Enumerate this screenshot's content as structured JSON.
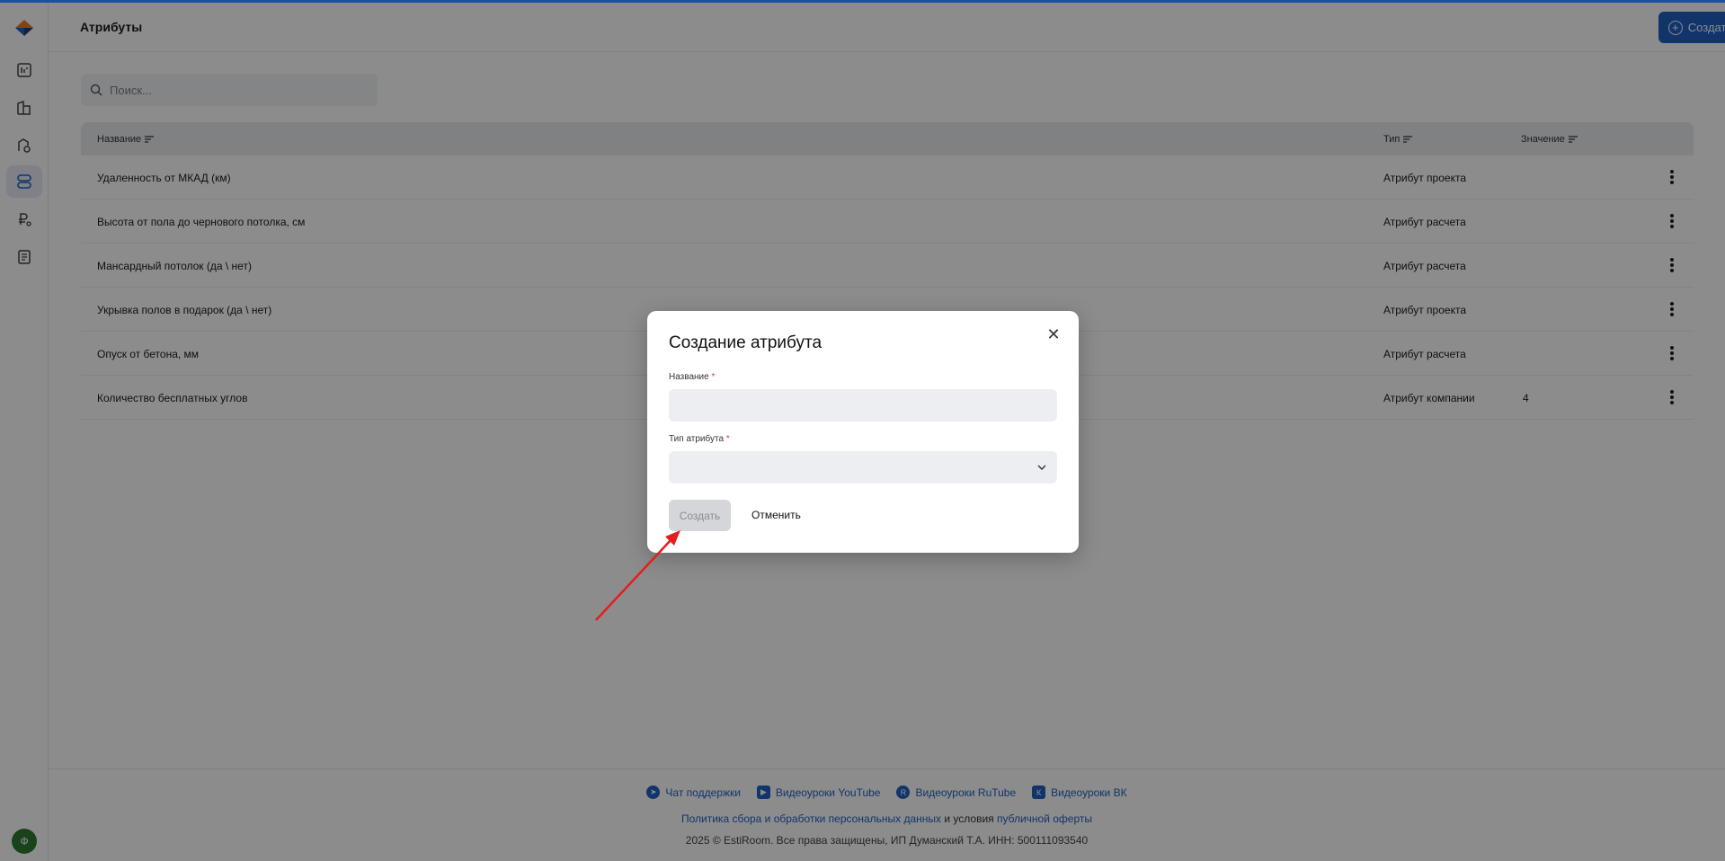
{
  "header": {
    "title": "Атрибуты",
    "create_label": "Создать"
  },
  "search": {
    "placeholder": "Поиск..."
  },
  "table": {
    "columns": [
      "Название",
      "Тип",
      "Значение"
    ],
    "rows": [
      {
        "name": "Удаленность от МКАД (км)",
        "type": "Атрибут проекта",
        "value": ""
      },
      {
        "name": "Высота от пола до чернового потолка, см",
        "type": "Атрибут расчета",
        "value": ""
      },
      {
        "name": "Мансардный потолок (да \\ нет)",
        "type": "Атрибут расчета",
        "value": ""
      },
      {
        "name": "Укрывка полов в подарок (да \\ нет)",
        "type": "Атрибут проекта",
        "value": ""
      },
      {
        "name": "Опуск от бетона, мм",
        "type": "Атрибут расчета",
        "value": ""
      },
      {
        "name": "Количество бесплатных углов",
        "type": "Атрибут компании",
        "value": "4"
      }
    ]
  },
  "sidebar": {
    "items": [
      "dashboard-icon",
      "buildings-icon",
      "materials-icon",
      "attributes-icon",
      "pricing-icon",
      "documents-icon"
    ],
    "user_initial": "Ф"
  },
  "footer": {
    "links": [
      {
        "label": "Чат поддержки",
        "icon": "telegram-icon"
      },
      {
        "label": "Видеоуроки YouTube",
        "icon": "youtube-icon"
      },
      {
        "label": "Видеоуроки RuTube",
        "icon": "rutube-icon"
      },
      {
        "label": "Видеоуроки ВК",
        "icon": "vk-icon"
      }
    ],
    "policy_link": "Политика сбора и обработки персональных данных",
    "policy_mid": " и условия ",
    "offer_link": "публичной оферты",
    "copyright": "2025 © EstiRoom. Все права защищены, ИП Думанский Т.А. ИНН: 500111093540"
  },
  "modal": {
    "title": "Создание атрибута",
    "name_label": "Название",
    "name_value": "",
    "type_label": "Тип атрибута",
    "type_value": "",
    "required_mark": "*",
    "create_label": "Создать",
    "cancel_label": "Отменить"
  },
  "colors": {
    "accent": "#1f5fc4",
    "required": "#e53935",
    "annotation_arrow": "#e31e1e"
  }
}
